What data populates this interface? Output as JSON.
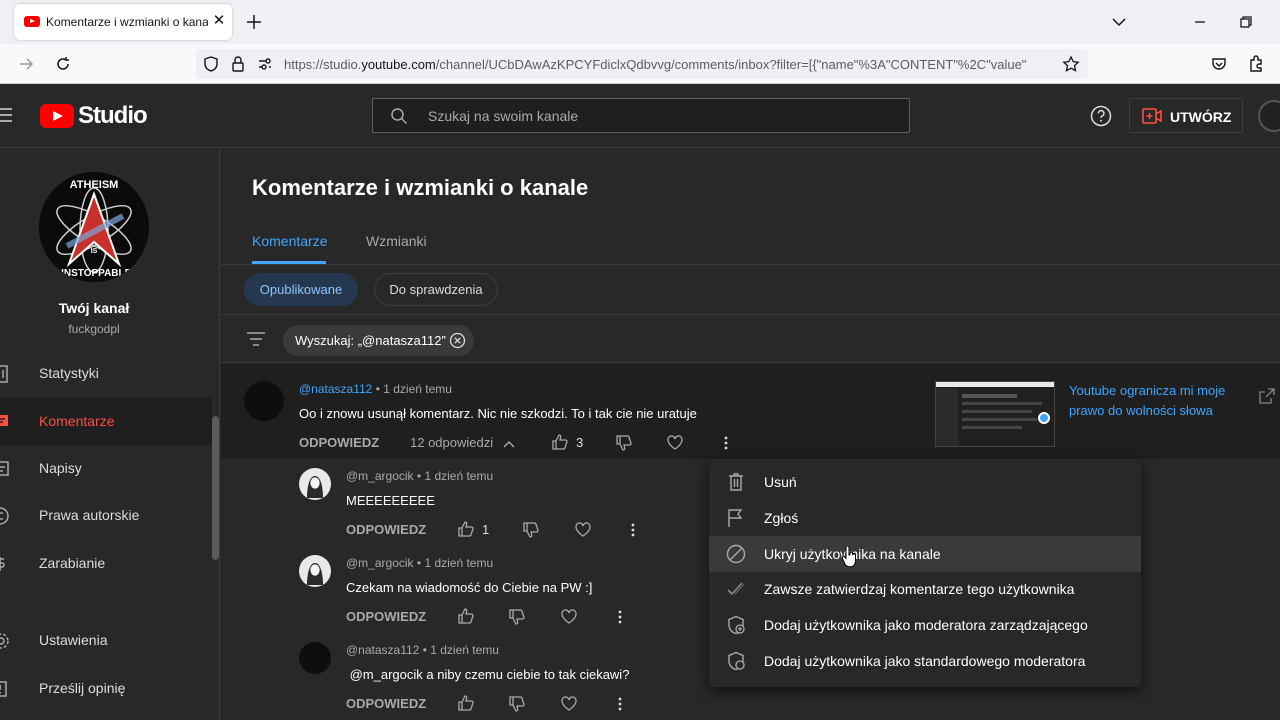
{
  "browser": {
    "tab_title": "Komentarze i wzmianki o kanale",
    "url_prefix": "https://studio.",
    "url_domain": "youtube.com",
    "url_rest": "/channel/UCbDAwAzKPCYFdiclxQdbvvg/comments/inbox?filter=[{\"name\"%3A\"CONTENT\"%2C\"value\""
  },
  "header": {
    "logo_text": "Studio",
    "search_placeholder": "Szukaj na swoim kanale",
    "create_label": "UTWÓRZ"
  },
  "sidebar": {
    "channel_name": "Twój kanał",
    "channel_handle": "fuckgodpl",
    "avatar_text_top": "ATHEISM",
    "avatar_text_mid": "IS",
    "avatar_text_bottom": "UNSTOPPABLE",
    "items": [
      {
        "label": "Statystyki",
        "icon": "chart-icon"
      },
      {
        "label": "Komentarze",
        "icon": "comments-icon"
      },
      {
        "label": "Napisy",
        "icon": "subtitles-icon"
      },
      {
        "label": "Prawa autorskie",
        "icon": "copyright-icon"
      },
      {
        "label": "Zarabianie",
        "icon": "dollar-icon"
      },
      {
        "label": "Ustawienia",
        "icon": "gear-icon"
      },
      {
        "label": "Prześlij opinię",
        "icon": "feedback-icon"
      }
    ]
  },
  "main": {
    "title": "Komentarze i wzmianki o kanale",
    "tabs": [
      {
        "label": "Komentarze"
      },
      {
        "label": "Wzmianki"
      }
    ],
    "chips": [
      {
        "label": "Opublikowane"
      },
      {
        "label": "Do sprawdzenia"
      }
    ],
    "filter_label": "Wyszukaj: „@natasza112”"
  },
  "comments": [
    {
      "author": "@natasza112",
      "time": "1 dzień temu",
      "text": "Oo i znowu usunął komentarz. Nic nie szkodzi. To i tak cie nie uratuje",
      "reply_label": "ODPOWIEDZ",
      "replies_count": "12 odpowiedzi",
      "likes": "3",
      "video_title": "Youtube ogranicza mi moje prawo do wolności słowa"
    }
  ],
  "replies": [
    {
      "author": "@m_argocik",
      "time": "1 dzień temu",
      "text": "MEEEEEEEEE",
      "reply_label": "ODPOWIEDZ",
      "likes": "1"
    },
    {
      "author": "@m_argocik",
      "time": "1 dzień temu",
      "text": "Czekam na wiadomość do Ciebie na PW :]",
      "reply_label": "ODPOWIEDZ",
      "likes": ""
    },
    {
      "author": "@natasza112",
      "time": "1 dzień temu",
      "text": " @m_argocik a niby czemu ciebie to tak ciekawi?",
      "reply_label": "ODPOWIEDZ",
      "likes": ""
    }
  ],
  "separator": "•",
  "menu": {
    "items": [
      {
        "label": "Usuń",
        "icon": "trash-icon"
      },
      {
        "label": "Zgłoś",
        "icon": "flag-icon"
      },
      {
        "label": "Ukryj użytkownika na kanale",
        "icon": "block-icon"
      },
      {
        "label": "Zawsze zatwierdzaj komentarze tego użytkownika",
        "icon": "check-icon"
      },
      {
        "label": "Dodaj użytkownika jako moderatora zarządzającego",
        "icon": "shield-add-icon"
      },
      {
        "label": "Dodaj użytkownika jako standardowego moderatora",
        "icon": "shield-icon"
      }
    ],
    "hovered_index": 2
  },
  "colors": {
    "accent": "#3ea6ff",
    "active_red": "#ff4e45",
    "brand_red": "#ff0000"
  }
}
